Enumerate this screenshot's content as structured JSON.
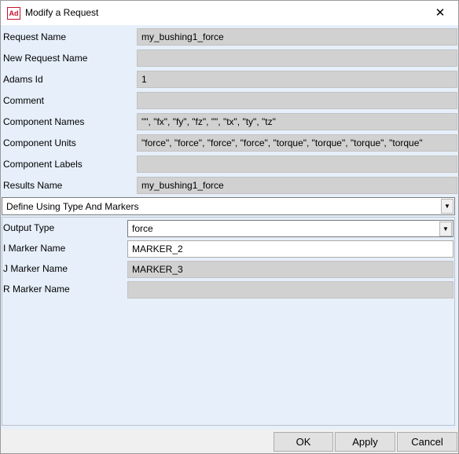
{
  "window": {
    "title": "Modify a Request",
    "app_icon_text": "Ad",
    "close_glyph": "✕"
  },
  "fields": {
    "request_name": {
      "label": "Request Name",
      "value": "my_bushing1_force"
    },
    "new_request_name": {
      "label": "New Request Name",
      "value": ""
    },
    "adams_id": {
      "label": "Adams Id",
      "value": "1"
    },
    "comment": {
      "label": "Comment",
      "value": ""
    },
    "component_names": {
      "label": "Component Names",
      "value": "\"\", \"fx\", \"fy\", \"fz\", \"\", \"tx\", \"ty\", \"tz\""
    },
    "component_units": {
      "label": "Component Units",
      "value": "\"force\", \"force\", \"force\", \"force\", \"torque\", \"torque\", \"torque\", \"torque\""
    },
    "component_labels": {
      "label": "Component Labels",
      "value": ""
    },
    "results_name": {
      "label": "Results Name",
      "value": "my_bushing1_force"
    }
  },
  "definition_mode": {
    "selected": "Define Using Type And Markers"
  },
  "panel": {
    "output_type": {
      "label": "Output Type",
      "value": "force"
    },
    "i_marker": {
      "label": "I Marker Name",
      "value": "MARKER_2"
    },
    "j_marker": {
      "label": "J Marker Name",
      "value": "MARKER_3"
    },
    "r_marker": {
      "label": "R Marker Name",
      "value": ""
    }
  },
  "buttons": {
    "ok": "OK",
    "apply": "Apply",
    "cancel": "Cancel"
  },
  "icons": {
    "dropdown": "chevron-down-icon",
    "close": "close-icon",
    "app": "adams-app-icon"
  },
  "colors": {
    "client_background": "#e6effa",
    "disabled_field": "#d1d1d1",
    "app_icon_red": "#c8102e"
  }
}
